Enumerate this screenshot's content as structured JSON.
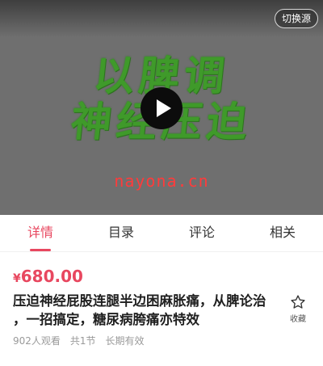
{
  "video": {
    "switch_source_label": "切换源",
    "cover_line1": "以脾调",
    "cover_line2": "神经压迫",
    "play_icon": "play-icon",
    "watermark": "nayona.cn"
  },
  "tabs": [
    {
      "label": "详情",
      "active": true
    },
    {
      "label": "目录",
      "active": false
    },
    {
      "label": "评论",
      "active": false
    },
    {
      "label": "相关",
      "active": false
    }
  ],
  "product": {
    "currency": "¥",
    "price": "680.00",
    "title": "压迫神经屁股连腿半边困麻胀痛，从脾论治 ，一招搞定，糖尿病胯痛亦特效",
    "collect_label": "收藏",
    "collect_icon": "star-outline-icon",
    "views": "902人观看",
    "lessons": "共1节",
    "validity": "长期有效"
  },
  "colors": {
    "accent": "#e8475f",
    "cover_text": "#3f9a2a",
    "watermark": "#ff3b3b",
    "video_bg": "#6f6f6f"
  }
}
